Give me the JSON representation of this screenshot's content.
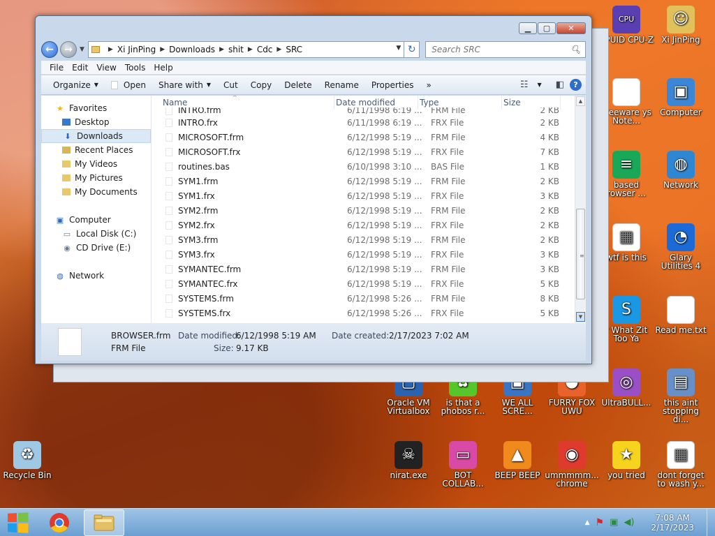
{
  "desktop": {
    "icons": [
      {
        "id": "cpuz",
        "label": "CPUID CPU-Z",
        "color": "#5a3fb3"
      },
      {
        "id": "xijinping",
        "label": "Xi JinPing",
        "color": "#e2c05b"
      },
      {
        "id": "freeware",
        "label": "Freeware ys Note...",
        "color": "#ffffff"
      },
      {
        "id": "computer",
        "label": "Computer",
        "color": "#3b86d6"
      },
      {
        "id": "based",
        "label": "based rowser ...",
        "color": "#19a858"
      },
      {
        "id": "network",
        "label": "Network",
        "color": "#2f86d2"
      },
      {
        "id": "wtf",
        "label": "wtf is this",
        "color": "#ffffff"
      },
      {
        "id": "glary",
        "label": "Glary Utilities 4",
        "color": "#1b6ad8"
      },
      {
        "id": "skype",
        "label": "r What Zit Too Ya",
        "color": "#1a98e4"
      },
      {
        "id": "readme",
        "label": "Read me.txt",
        "color": "#ffffff"
      },
      {
        "id": "oracle",
        "label": "Oracle VM Virtualbox",
        "color": "#2a63b0"
      },
      {
        "id": "phobos",
        "label": "is that a phobos r...",
        "color": "#56c62a"
      },
      {
        "id": "weall",
        "label": "WE ALL SCRE...",
        "color": "#3a75c4"
      },
      {
        "id": "furryfox",
        "label": "FURRY FOX UWU",
        "color": "#e8622b"
      },
      {
        "id": "ultrabull",
        "label": "UltraBULL...",
        "color": "#9a4fc7"
      },
      {
        "id": "thisaint",
        "label": "this aint stopping di...",
        "color": "#6890c8"
      },
      {
        "id": "recyclebin",
        "label": "Recycle Bin",
        "color": "#9ec8e4"
      },
      {
        "id": "nirat",
        "label": "nirat.exe",
        "color": "#222222"
      },
      {
        "id": "botcollab",
        "label": "BOT COLLAB...",
        "color": "#d84aa6"
      },
      {
        "id": "beepbeep",
        "label": "BEEP BEEP",
        "color": "#f08a1c"
      },
      {
        "id": "chrome",
        "label": "ummmmm... chrome",
        "color": "#de3b2e"
      },
      {
        "id": "youtried",
        "label": "you tried",
        "color": "#f6d31c"
      },
      {
        "id": "dontforget",
        "label": "dont forget to wash y...",
        "color": "#ffffff"
      }
    ]
  },
  "window": {
    "controls": {
      "minimize": "▁",
      "maximize": "▢",
      "close": "✕"
    },
    "address": [
      "Xi JinPing",
      "Downloads",
      "shit",
      "Cdc",
      "SRC"
    ],
    "search_placeholder": "Search SRC",
    "menu": [
      "File",
      "Edit",
      "View",
      "Tools",
      "Help"
    ],
    "commands": {
      "organize": "Organize",
      "open": "Open",
      "share_with": "Share with",
      "cut": "Cut",
      "copy": "Copy",
      "delete": "Delete",
      "rename": "Rename",
      "properties": "Properties",
      "more": "»"
    },
    "nav": {
      "favorites": "Favorites",
      "desktop": "Desktop",
      "downloads": "Downloads",
      "recent_places": "Recent Places",
      "my_videos": "My Videos",
      "my_pictures": "My Pictures",
      "my_documents": "My Documents",
      "computer": "Computer",
      "local_disk": "Local Disk (C:)",
      "cd_drive": "CD Drive (E:)",
      "network": "Network"
    },
    "columns": {
      "name": "Name",
      "date": "Date modified",
      "type": "Type",
      "size": "Size"
    },
    "partial_row": {
      "name": "INTRO.frm",
      "date": "6/11/1998 6:19 ...",
      "type": "FRM File",
      "size": "2 KB"
    },
    "files": [
      {
        "name": "INTRO.frx",
        "date": "6/11/1998 6:19 ...",
        "type": "FRX File",
        "size": "2 KB"
      },
      {
        "name": "MICROSOFT.frm",
        "date": "6/12/1998 5:19 ...",
        "type": "FRM File",
        "size": "4 KB"
      },
      {
        "name": "MICROSOFT.frx",
        "date": "6/12/1998 5:19 ...",
        "type": "FRX File",
        "size": "7 KB"
      },
      {
        "name": "routines.bas",
        "date": "6/10/1998 3:10 ...",
        "type": "BAS File",
        "size": "1 KB"
      },
      {
        "name": "SYM1.frm",
        "date": "6/12/1998 5:19 ...",
        "type": "FRM File",
        "size": "2 KB"
      },
      {
        "name": "SYM1.frx",
        "date": "6/12/1998 5:19 ...",
        "type": "FRX File",
        "size": "3 KB"
      },
      {
        "name": "SYM2.frm",
        "date": "6/12/1998 5:19 ...",
        "type": "FRM File",
        "size": "2 KB"
      },
      {
        "name": "SYM2.frx",
        "date": "6/12/1998 5:19 ...",
        "type": "FRX File",
        "size": "2 KB"
      },
      {
        "name": "SYM3.frm",
        "date": "6/12/1998 5:19 ...",
        "type": "FRM File",
        "size": "2 KB"
      },
      {
        "name": "SYM3.frx",
        "date": "6/12/1998 5:19 ...",
        "type": "FRX File",
        "size": "3 KB"
      },
      {
        "name": "SYMANTEC.frm",
        "date": "6/12/1998 5:19 ...",
        "type": "FRM File",
        "size": "3 KB"
      },
      {
        "name": "SYMANTEC.frx",
        "date": "6/12/1998 5:19 ...",
        "type": "FRX File",
        "size": "5 KB"
      },
      {
        "name": "SYSTEMS.frm",
        "date": "6/12/1998 5:26 ...",
        "type": "FRM File",
        "size": "8 KB"
      },
      {
        "name": "SYSTEMS.frx",
        "date": "6/12/1998 5:26 ...",
        "type": "FRX File",
        "size": "5 KB"
      }
    ],
    "details": {
      "filename": "BROWSER.frm",
      "modified_label": "Date modified:",
      "modified_value": "6/12/1998 5:19 AM",
      "created_label": "Date created:",
      "created_value": "2/17/2023 7:02 AM",
      "type": "FRM File",
      "size_label": "Size:",
      "size_value": "9.17 KB"
    }
  },
  "taskbar": {
    "time": "7:08 AM",
    "date": "2/17/2023",
    "tray_overflow": "▲"
  }
}
